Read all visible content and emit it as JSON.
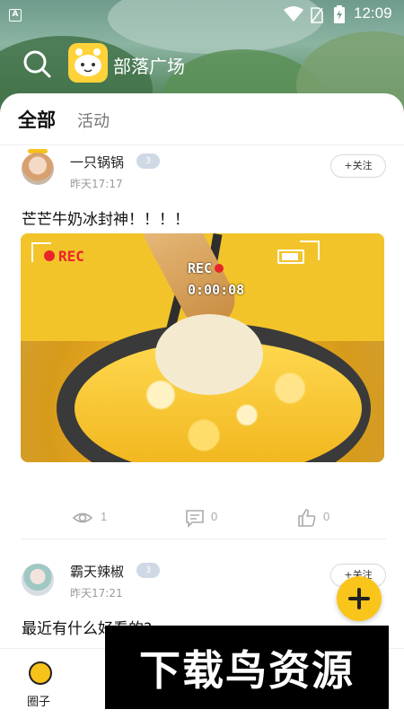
{
  "status_bar": {
    "time": "12:09",
    "left_icon": "A"
  },
  "header": {
    "title": "部落广场"
  },
  "tabs": [
    {
      "label": "全部",
      "active": true
    },
    {
      "label": "活动",
      "active": false
    }
  ],
  "posts": [
    {
      "username": "一只锅锅",
      "level": "3",
      "time": "昨天17:17",
      "follow_label": "+关注",
      "text": "芒芒牛奶冰封神！！！！",
      "image_overlay": {
        "rec_left": "REC",
        "rec_center": "REC",
        "timecode": "0:00:08"
      },
      "views": "1",
      "comments": "0",
      "likes": "0"
    },
    {
      "username": "霸天辣椒",
      "level": "3",
      "time": "昨天17:21",
      "follow_label": "+关注",
      "text": "最近有什么好看的?"
    }
  ],
  "bottom_nav": [
    {
      "label": "圈子",
      "icon": "circle-icon"
    }
  ],
  "watermark": {
    "text": "下载鸟资源"
  },
  "colors": {
    "accent": "#f7c21a",
    "fab": "#f9c51b"
  }
}
